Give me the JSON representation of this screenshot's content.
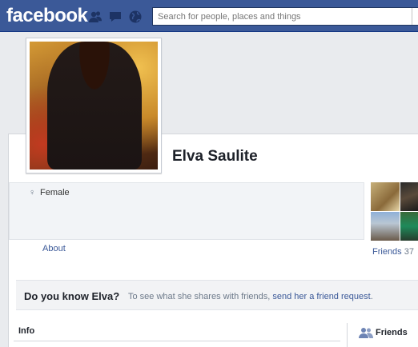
{
  "topbar": {
    "logo": "facebook",
    "search_placeholder": "Search for people, places and things",
    "jewels": [
      "friend-requests-icon",
      "messages-icon",
      "notifications-icon"
    ],
    "bg_color": "#3b5998"
  },
  "profile": {
    "name": "Elva Saulite",
    "gender_symbol": "♀",
    "gender": "Female",
    "about_link": "About",
    "friends_label": "Friends",
    "friends_count": "37"
  },
  "know": {
    "title": "Do you know Elva?",
    "text_prefix": "To see what she shares with friends,",
    "link": "send her a friend request",
    "text_suffix": "."
  },
  "sections": {
    "info": "Info",
    "friends": "Friends"
  }
}
